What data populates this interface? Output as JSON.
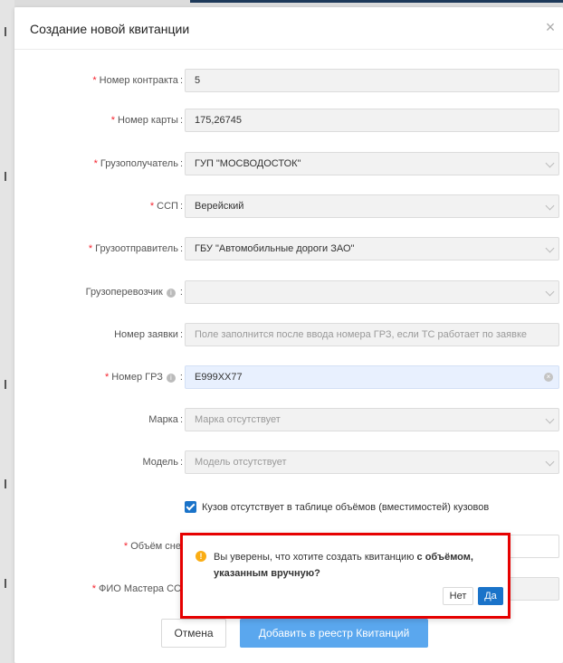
{
  "modal": {
    "title": "Создание новой квитанции",
    "close_icon": "×"
  },
  "fields": {
    "contract": {
      "label": "Номер контракта",
      "value": "5"
    },
    "card": {
      "label": "Номер карты",
      "value": "175,26745"
    },
    "consignee": {
      "label": "Грузополучатель",
      "value": "ГУП \"МОСВОДОСТОК\""
    },
    "ssp": {
      "label": "ССП",
      "value": "Верейский"
    },
    "shipper": {
      "label": "Грузоотправитель",
      "value": "ГБУ \"Автомобильные дороги ЗАО\""
    },
    "carrier": {
      "label": "Грузоперевозчик",
      "value": ""
    },
    "request": {
      "label": "Номер заявки",
      "placeholder": "Поле заполнится после ввода номера ГРЗ, если ТС работает по заявке"
    },
    "plate": {
      "label": "Номер ГРЗ",
      "value": "Е999ХХ77"
    },
    "brand": {
      "label": "Марка",
      "placeholder": "Марка отсутствует"
    },
    "model": {
      "label": "Модель",
      "placeholder": "Модель отсутствует"
    },
    "volume": {
      "label": "Объём сне"
    },
    "master": {
      "label": "ФИО Мастера СС"
    }
  },
  "checkbox": {
    "label": "Кузов отсутствует в таблице объёмов (вместимостей) кузовов",
    "checked": true
  },
  "popconfirm": {
    "text_prefix": "Вы уверены, что хотите создать квитанцию ",
    "text_bold": "с объёмом, указанным вручную?",
    "no_label": "Нет",
    "yes_label": "Да"
  },
  "buttons": {
    "cancel": "Отмена",
    "submit": "Добавить в реестр Квитанций"
  },
  "colors": {
    "accent": "#1a73c9",
    "required": "#f5222d",
    "warning": "#faad14",
    "highlight_border": "#e60000"
  }
}
